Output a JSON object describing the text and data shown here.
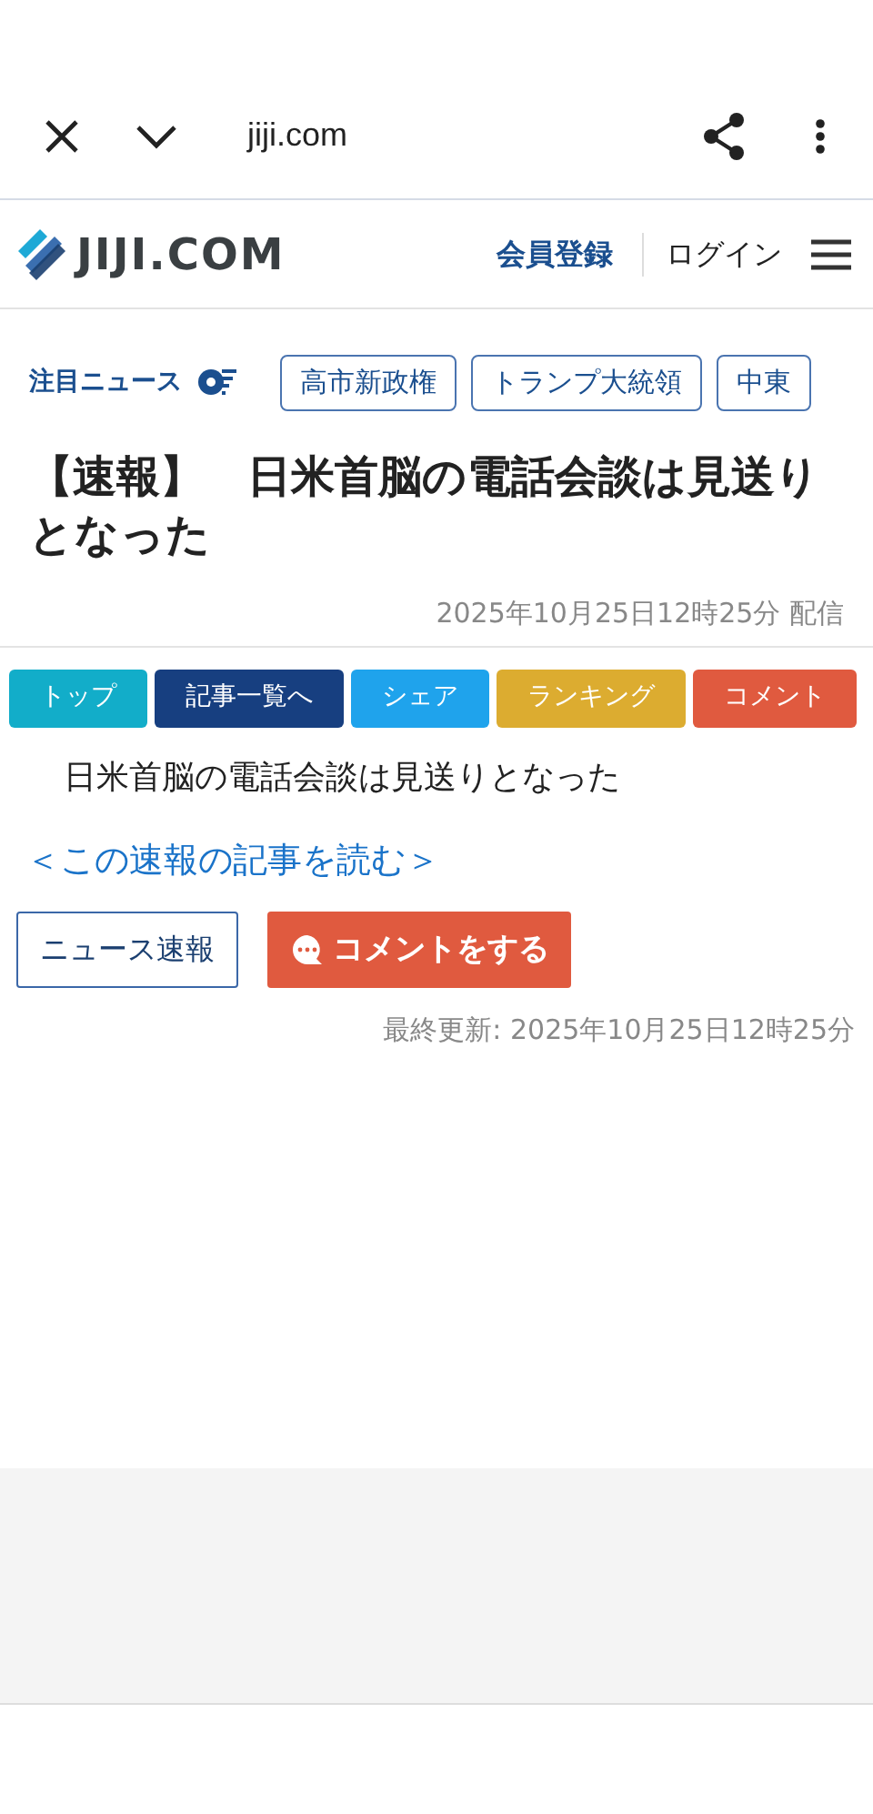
{
  "browser_bar": {
    "url": "jiji.com"
  },
  "site_header": {
    "logo": "JIJI.COM",
    "links": [
      {
        "label": "会員登録",
        "kind": "register"
      },
      {
        "label": "ログイン",
        "kind": "login"
      }
    ]
  },
  "featured": {
    "label": "注目ニュース",
    "tags": [
      "高市新政権",
      "トランプ大統領",
      "中東"
    ]
  },
  "article": {
    "title": "【速報】　日米首脳の電話会談は見送りとなった",
    "published": "2025年10月25日12時25分 配信",
    "actions": [
      {
        "label": "トップ",
        "color": "#12adc9"
      },
      {
        "label": "記事一覧へ",
        "color": "#173f80"
      },
      {
        "label": "シェア",
        "color": "#1fa3ec"
      },
      {
        "label": "ランキング",
        "color": "#dcac30"
      },
      {
        "label": "コメント",
        "color": "#e05a3f"
      }
    ],
    "body": "日米首脳の電話会談は見送りとなった",
    "read_link": "＜この速報の記事を読む＞",
    "category_button": "ニュース速報",
    "comment_button": "コメントをする",
    "updated": "最終更新: 2025年10月25日12時25分"
  }
}
